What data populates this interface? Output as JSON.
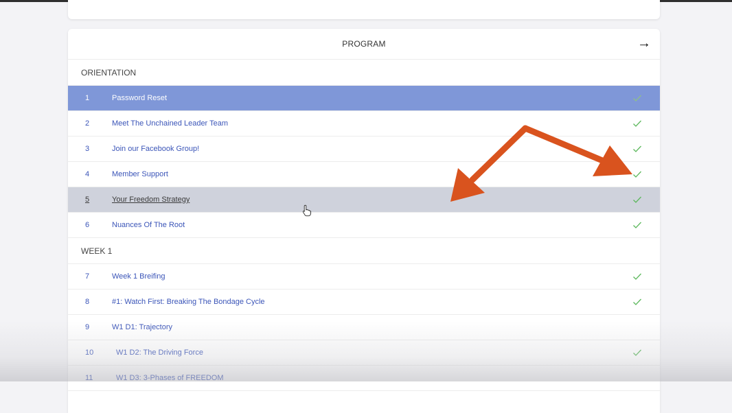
{
  "program": {
    "title": "PROGRAM",
    "sections": [
      {
        "label": "ORIENTATION",
        "items": [
          {
            "num": "1",
            "title": "Password Reset",
            "completed": true,
            "state": "active"
          },
          {
            "num": "2",
            "title": "Meet The Unchained Leader Team",
            "completed": true,
            "state": "normal"
          },
          {
            "num": "3",
            "title": "Join our Facebook Group!",
            "completed": true,
            "state": "normal"
          },
          {
            "num": "4",
            "title": "Member Support",
            "completed": true,
            "state": "normal"
          },
          {
            "num": "5",
            "title": "Your Freedom Strategy",
            "completed": true,
            "state": "hover"
          },
          {
            "num": "6",
            "title": "Nuances Of The Root",
            "completed": true,
            "state": "normal"
          }
        ]
      },
      {
        "label": "WEEK 1",
        "items": [
          {
            "num": "7",
            "title": "Week 1 Breifing",
            "completed": true,
            "state": "normal"
          },
          {
            "num": "8",
            "title": "#1: Watch First: Breaking The Bondage Cycle",
            "completed": true,
            "state": "normal"
          },
          {
            "num": "9",
            "title": "W1 D1: Trajectory",
            "completed": false,
            "state": "normal"
          },
          {
            "num": "10",
            "title": "W1 D2: The Driving Force",
            "completed": true,
            "state": "normal"
          },
          {
            "num": "11",
            "title": "W1 D3: 3-Phases of FREEDOM",
            "completed": false,
            "state": "normal"
          }
        ]
      }
    ]
  },
  "icons": {
    "next": "arrow-right-icon",
    "complete": "checkmark-icon",
    "cursor": "hand-pointer-icon"
  },
  "colors": {
    "active_row": "#7f97d8",
    "hover_row": "#cfd2dc",
    "link": "#3b55b8",
    "check": "#5cb85c",
    "annotation_arrow": "#d9531e"
  }
}
